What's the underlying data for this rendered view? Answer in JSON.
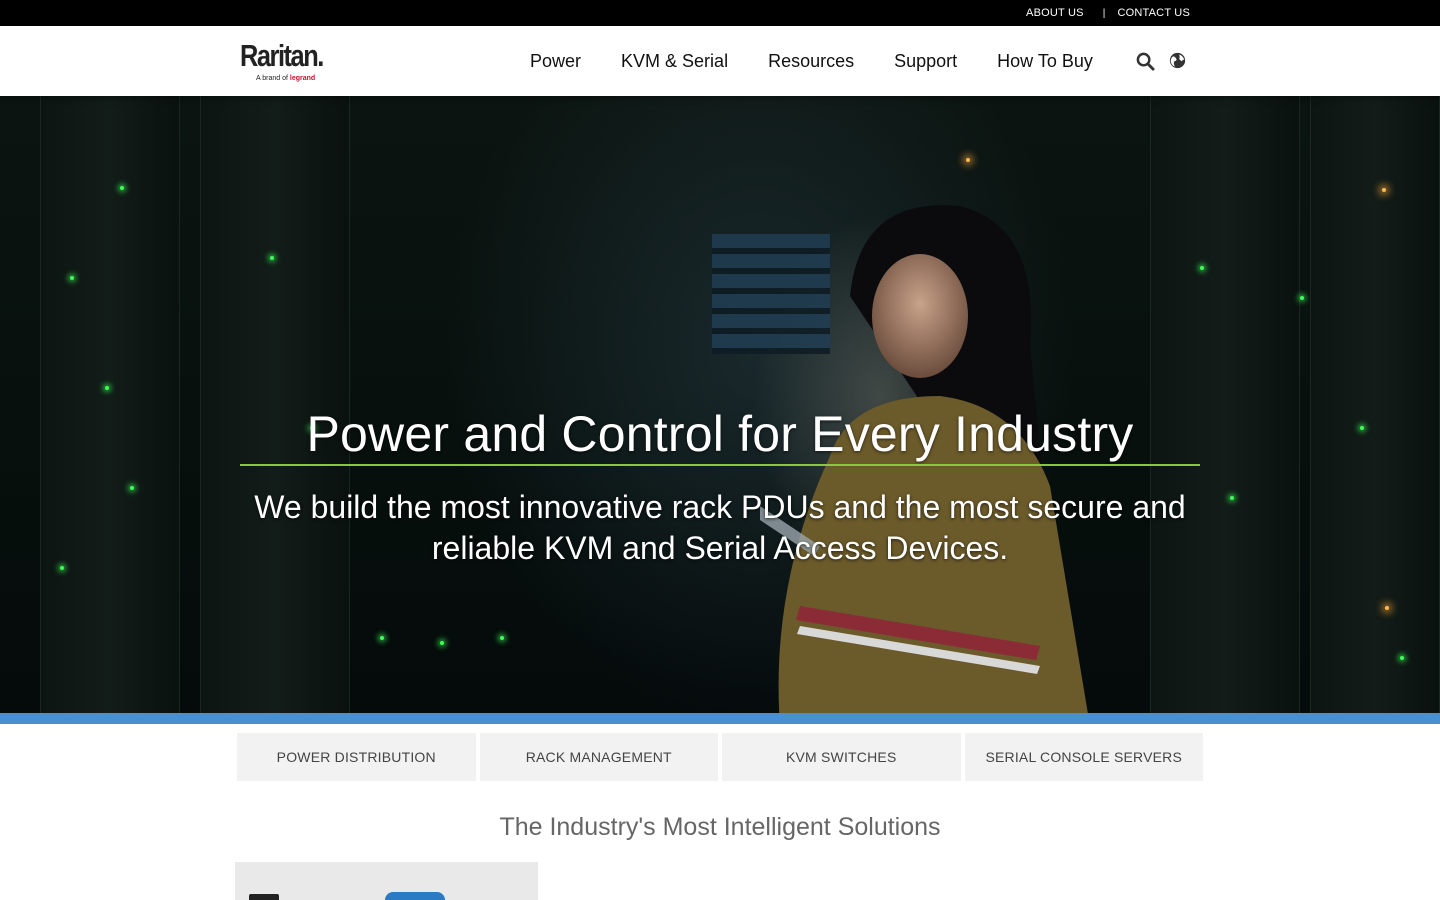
{
  "utility": {
    "about": "ABOUT US",
    "separator": "|",
    "contact": "CONTACT US"
  },
  "logo": {
    "word": "Raritan.",
    "brand_prefix": "A brand of",
    "brand_name": "legrand"
  },
  "nav": {
    "items": [
      {
        "label": "Power"
      },
      {
        "label": "KVM & Serial"
      },
      {
        "label": "Resources"
      },
      {
        "label": "Support"
      },
      {
        "label": "How To Buy"
      }
    ],
    "icons": [
      "search-icon",
      "globe-icon"
    ]
  },
  "hero": {
    "title": "Power and Control for Every Industry",
    "subtitle": "We build the most innovative rack PDUs and the most secure and reliable KVM and Serial Access Devices."
  },
  "categories": [
    {
      "label": "POWER DISTRIBUTION"
    },
    {
      "label": "RACK MANAGEMENT"
    },
    {
      "label": "KVM SWITCHES"
    },
    {
      "label": "SERIAL CONSOLE SERVERS"
    }
  ],
  "section": {
    "title": "The Industry's Most Intelligent Solutions"
  },
  "colors": {
    "accent_green": "#8cc63f",
    "accent_blue": "#4a8fd0",
    "brand_red": "#c8102e"
  }
}
